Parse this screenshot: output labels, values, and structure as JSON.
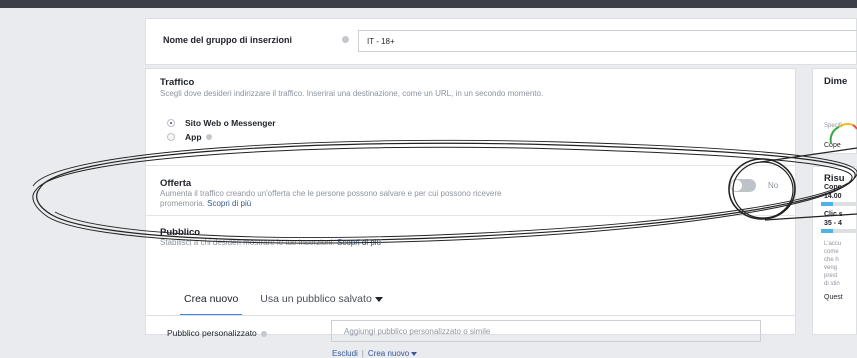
{
  "ad_set": {
    "name_label": "Nome del gruppo di inserzioni",
    "name_value": "IT - 18+"
  },
  "traffic": {
    "title": "Traffico",
    "description": "Scegli dove desideri indirizzare il traffico. Inserirai una destinazione, come un URL, in un secondo momento.",
    "options": [
      {
        "label": "Sito Web o Messenger",
        "selected": true
      },
      {
        "label": "App",
        "selected": false
      }
    ]
  },
  "offer": {
    "title": "Offerta",
    "description": "Aumenta il traffico creando un'offerta che le persone possono salvare e per cui possono ricevere promemoria.",
    "learn_more": "Scopri di più",
    "toggle_label": "No",
    "enabled": false
  },
  "audience": {
    "title": "Pubblico",
    "description": "Stabilisci a chi desideri mostrare le tue inserzioni.",
    "learn_more": "Scopri di più",
    "tabs": [
      "Crea nuovo",
      "Usa un pubblico salvato"
    ],
    "active_tab": 0,
    "custom_audience_label": "Pubblico personalizzato",
    "custom_audience_placeholder": "Aggiungi pubblico personalizzato o simile",
    "exclude_label": "Escludi",
    "create_new_label": "Crea nuovo"
  },
  "sidebar": {
    "dimension": {
      "title": "Dime",
      "gauge_label": "Specifi",
      "coverage": "Cope"
    },
    "results": {
      "title": "Risu",
      "coverage_label": "Cope",
      "coverage_value": "14.00",
      "clicks_label": "Clic s",
      "clicks_value": "35 - 4",
      "note_lines": [
        "L'accu",
        "come",
        "che h",
        "veng",
        "prest",
        "di stin"
      ],
      "link": "Quest"
    }
  },
  "colors": {
    "page_bg": "#e9ebee",
    "card_bg": "#ffffff",
    "link": "#365899",
    "accent": "#4080ff",
    "bar": "#4cb5e6"
  }
}
